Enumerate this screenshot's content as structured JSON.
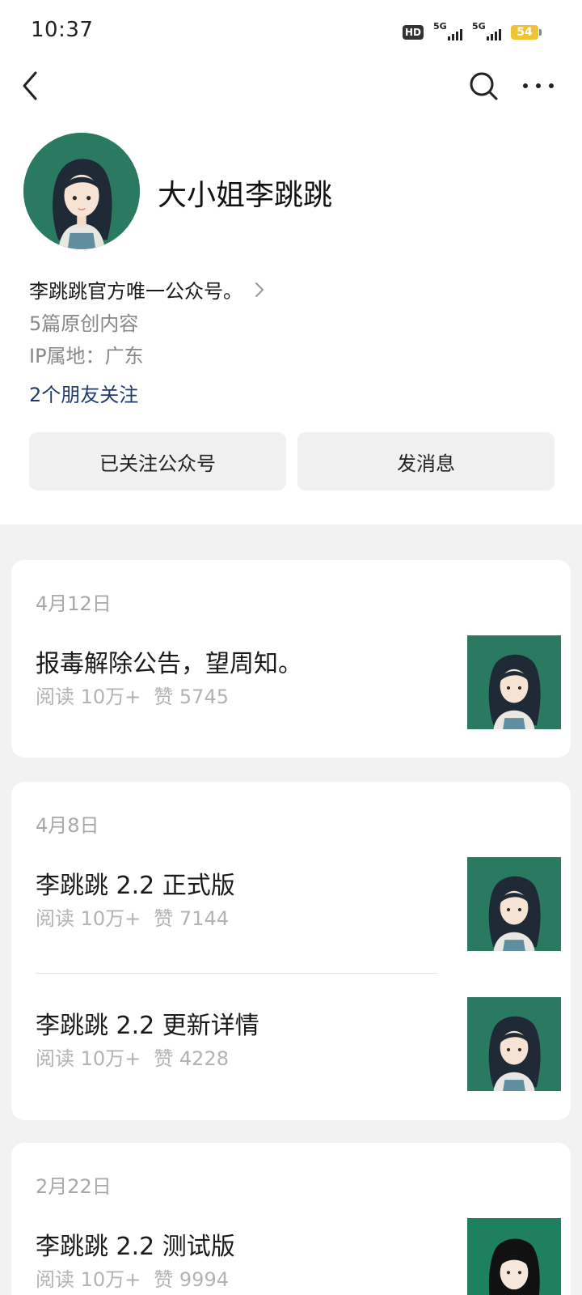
{
  "status_bar": {
    "time": "10:37",
    "hd_label": "HD",
    "sim1_network": "5G",
    "sim2_network": "5G",
    "battery_level": "54",
    "battery_color": "#f1c232"
  },
  "nav": {
    "back_icon": "chevron-left-icon",
    "search_icon": "search-icon",
    "more_icon": "more-horizontal-icon"
  },
  "profile": {
    "name": "大小姐李跳跳",
    "intro": "李跳跳官方唯一公众号。",
    "original_count": "5篇原创内容",
    "ip_location": "IP属地：广东",
    "friends_following": "2个朋友关注",
    "avatar_bg": "#2a7a62",
    "link_color": "#1e3a6e"
  },
  "actions": {
    "follow_label": "已关注公众号",
    "message_label": "发消息"
  },
  "feed": [
    {
      "date": "4月12日",
      "articles": [
        {
          "title": "报毒解除公告，望周知。",
          "reads": "阅读 10万+",
          "likes": "赞 5745"
        }
      ]
    },
    {
      "date": "4月8日",
      "articles": [
        {
          "title": "李跳跳 2.2 正式版",
          "reads": "阅读 10万+",
          "likes": "赞 7144"
        },
        {
          "title": "李跳跳 2.2 更新详情",
          "reads": "阅读 10万+",
          "likes": "赞 4228"
        }
      ]
    },
    {
      "date": "2月22日",
      "articles": [
        {
          "title": "李跳跳 2.2 测试版",
          "reads": "阅读 10万+",
          "likes": "赞 9994"
        }
      ]
    }
  ]
}
